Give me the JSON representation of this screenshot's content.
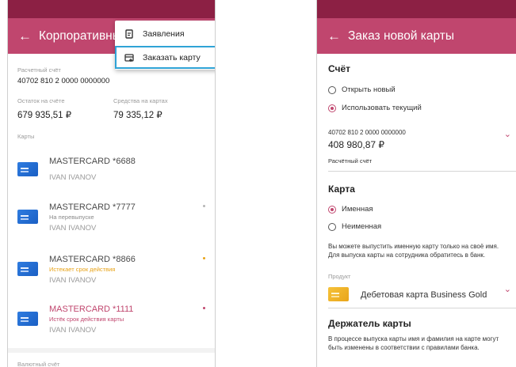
{
  "left_screen": {
    "title": "Корпоративные",
    "menu": [
      {
        "label": "Заявления"
      },
      {
        "label": "Заказать карту"
      }
    ],
    "account_label": "Расчетный счёт",
    "account_number": "40702 810 2 0000 0000000",
    "balance_label": "Остаток на счёте",
    "balance_value": "679 935,51 ₽",
    "cards_funds_label": "Средства на картах",
    "cards_funds_value": "79 335,12 ₽",
    "cards_label": "Карты",
    "cards": [
      {
        "title": "MASTERCARD *6688",
        "status": "",
        "owner": "IVAN IVANOV"
      },
      {
        "title": "MASTERCARD *7777",
        "status": "На перевыпуске",
        "owner": "IVAN IVANOV"
      },
      {
        "title": "MASTERCARD *8866",
        "status": "Истекает срок действия",
        "owner": "IVAN IVANOV"
      },
      {
        "title": "MASTERCARD *1111",
        "status": "Истёк срок действия карты",
        "owner": "IVAN IVANOV"
      }
    ],
    "bottom_label": "Валютный счёт"
  },
  "right_screen": {
    "title": "Заказ новой карты",
    "account_heading": "Счёт",
    "radio_open_new": "Открыть новый",
    "radio_use_current": "Использовать текущий",
    "account_number": "40702 810 2 0000 0000000",
    "account_balance": "408 980,87 ₽",
    "account_type": "Расчётный счёт",
    "card_heading": "Карта",
    "radio_named": "Именная",
    "radio_unnamed": "Неименная",
    "named_note": "Вы можете выпустить именную карту только на своё имя. Для выпуска карты на сотрудника обратитесь в банк.",
    "product_label": "Продукт",
    "product_value": "Дебетовая карта Business Gold",
    "holder_heading": "Держатель карты",
    "holder_note": "В процессе выпуска карты имя и фамилия на карте могут быть изменены в соответствии с правилами банка."
  },
  "colors": {
    "status_bar": "#8c2044",
    "app_bar": "#c0466e",
    "accent": "#c0466e",
    "warning": "#e8a317",
    "error": "#c0466e",
    "highlight_border": "#2fa3d6"
  },
  "icons": [
    "back-arrow-icon",
    "document-icon",
    "card-order-icon",
    "card-icon",
    "chevron-down-icon",
    "radio-icon"
  ]
}
